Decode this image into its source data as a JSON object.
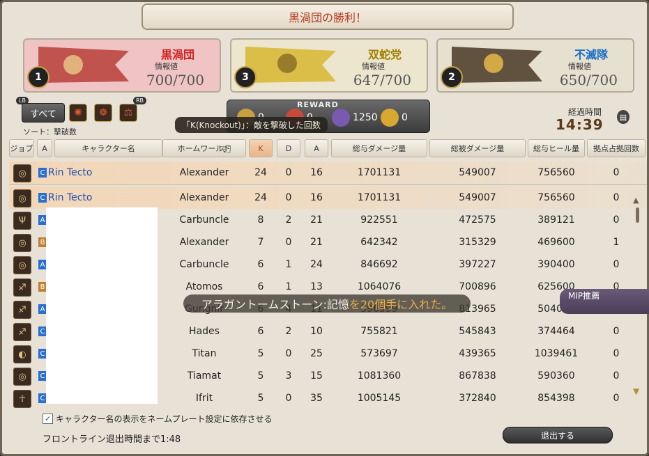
{
  "title": "黒渦団の勝利！",
  "teams": [
    {
      "rank": "1",
      "name": "黒渦団",
      "info_label": "情報値",
      "info_value": "700/700",
      "color": "#d02020",
      "bg": "#f0c4c4"
    },
    {
      "rank": "3",
      "name": "双蛇党",
      "info_label": "情報値",
      "info_value": "647/700",
      "color": "#a08000",
      "bg": "#ece6cf"
    },
    {
      "rank": "2",
      "name": "不滅隊",
      "info_label": "情報値",
      "info_value": "650/700",
      "color": "#1a6fc8",
      "bg": "#e6e0d0"
    }
  ],
  "controls": {
    "all_button": "すべて",
    "lb": "LB",
    "rb": "RB",
    "sort_label": "ソート：撃破数"
  },
  "reward": {
    "title": "REWARD",
    "items": [
      "0",
      "0",
      "1250",
      "0"
    ]
  },
  "tooltip": "「K(Knockout)」：敵を撃破した回数",
  "elapsed": {
    "label": "経過時間",
    "time": "14:39"
  },
  "columns": [
    "ジョブ",
    "A",
    "キャラクター名",
    "ホームワールド",
    "K",
    "D",
    "A",
    "総与ダメージ量",
    "総被ダメージ量",
    "総与ヒール量",
    "拠点占拠回数"
  ],
  "self_row": {
    "team": "C",
    "name": "Rin Tecto",
    "world": "Alexander",
    "k": "24",
    "d": "0",
    "a": "16",
    "dmg": "1701131",
    "taken": "549007",
    "heal": "756560",
    "cap": "0"
  },
  "rows": [
    {
      "team": "C",
      "name": "Rin Tecto",
      "world": "Alexander",
      "k": "24",
      "d": "0",
      "a": "16",
      "dmg": "1701131",
      "taken": "549007",
      "heal": "756560",
      "cap": "0"
    },
    {
      "team": "A",
      "name": "",
      "world": "Carbuncle",
      "k": "8",
      "d": "2",
      "a": "21",
      "dmg": "922551",
      "taken": "472575",
      "heal": "389121",
      "cap": "0"
    },
    {
      "team": "B",
      "name": "",
      "world": "Alexander",
      "k": "7",
      "d": "0",
      "a": "21",
      "dmg": "642342",
      "taken": "315329",
      "heal": "469600",
      "cap": "1"
    },
    {
      "team": "A",
      "name": "",
      "world": "Carbuncle",
      "k": "6",
      "d": "1",
      "a": "24",
      "dmg": "846692",
      "taken": "397227",
      "heal": "390400",
      "cap": "0"
    },
    {
      "team": "B",
      "name": "",
      "world": "Atomos",
      "k": "6",
      "d": "1",
      "a": "13",
      "dmg": "1064076",
      "taken": "700896",
      "heal": "625600",
      "cap": "0"
    },
    {
      "team": "A",
      "name": "",
      "world": "Gungnir",
      "k": "6",
      "d": "4",
      "a": "11",
      "dmg": "596599",
      "taken": "813965",
      "heal": "504000",
      "cap": "0"
    },
    {
      "team": "C",
      "name": "",
      "world": "Hades",
      "k": "6",
      "d": "2",
      "a": "10",
      "dmg": "755821",
      "taken": "545843",
      "heal": "374464",
      "cap": "0"
    },
    {
      "team": "C",
      "name": "",
      "world": "Titan",
      "k": "5",
      "d": "0",
      "a": "25",
      "dmg": "573697",
      "taken": "439365",
      "heal": "1039461",
      "cap": "0"
    },
    {
      "team": "C",
      "name": "",
      "world": "Tiamat",
      "k": "5",
      "d": "3",
      "a": "15",
      "dmg": "1081360",
      "taken": "867838",
      "heal": "590360",
      "cap": "0"
    },
    {
      "team": "C",
      "name": "",
      "world": "Ifrit",
      "k": "5",
      "d": "0",
      "a": "35",
      "dmg": "1005145",
      "taken": "372840",
      "heal": "854398",
      "cap": "0"
    }
  ],
  "banner": {
    "prefix": "アラガントームストーン:記憶",
    "highlight": "を20個手に入れた。"
  },
  "mip": "MIP推薦",
  "footer": {
    "checkbox_label": "キャラクター名の表示をネームプレート設定に依存させる",
    "countdown": "フロントライン退出時間まで1:48",
    "exit_button": "退出する"
  },
  "team_colors": {
    "A": "#2a6fd0",
    "B": "#c08030",
    "C": "#2a6fd0"
  }
}
